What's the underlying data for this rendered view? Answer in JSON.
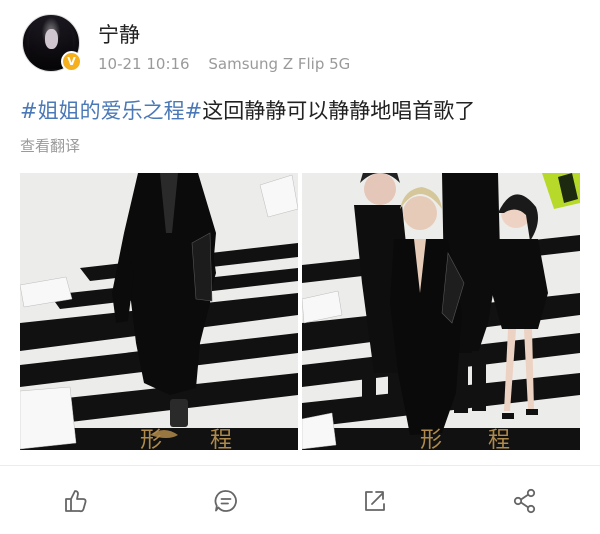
{
  "post": {
    "username": "宁静",
    "time": "10-21 10:16",
    "device": "Samsung Z Flip 5G",
    "topic": "#姐姐的爱乐之程#",
    "text": "这回静静可以静静地唱首歌了",
    "translate_label": "查看翻译",
    "verified_badge": "V"
  },
  "images": [
    {
      "icon": "photo-left-woman-in-black"
    },
    {
      "icon": "photo-group-women-in-black"
    }
  ],
  "actions": [
    {
      "icon": "like-icon"
    },
    {
      "icon": "comment-icon"
    },
    {
      "icon": "repost-icon"
    },
    {
      "icon": "share-icon"
    }
  ],
  "colors": {
    "topic": "#4b79b8",
    "meta": "#9a9a9a",
    "badge": "#f6b01c"
  }
}
